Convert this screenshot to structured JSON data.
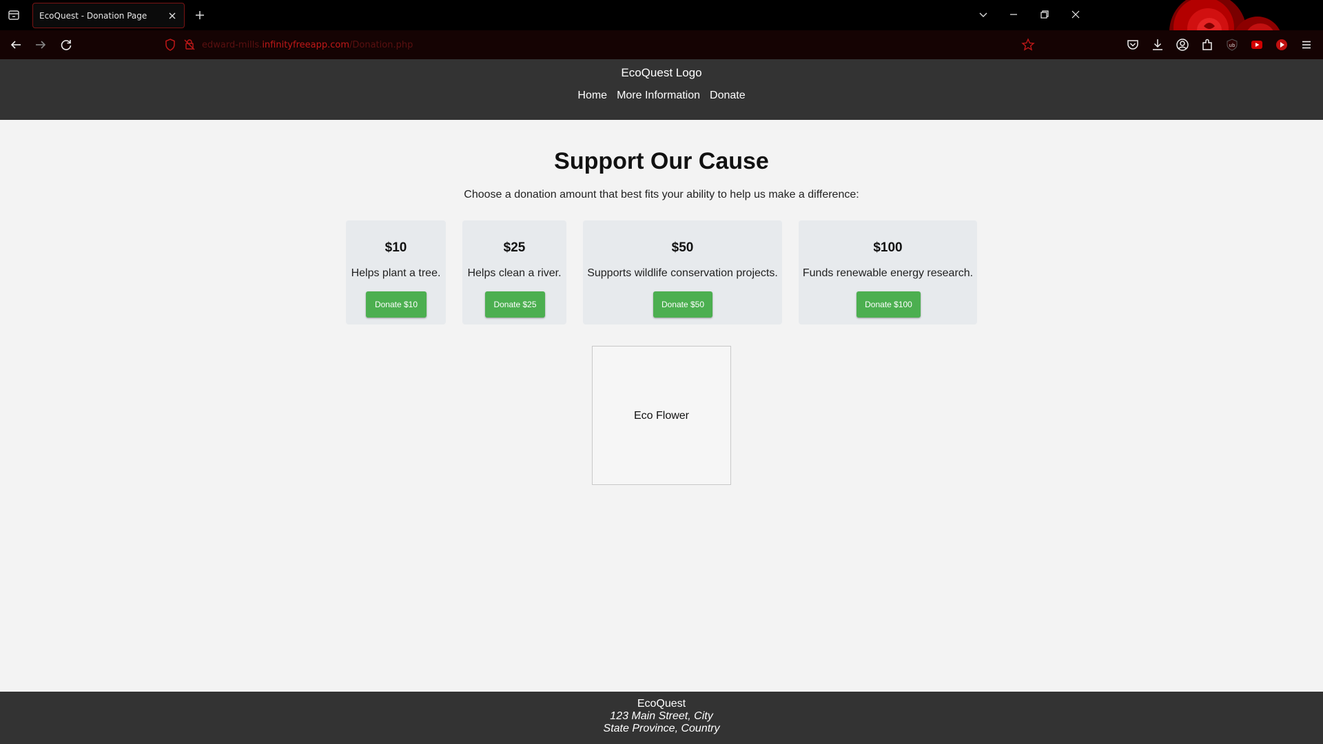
{
  "browser": {
    "tab_title": "EcoQuest - Donation Page",
    "url_prefix": "edward-mills.",
    "url_domain": "infinityfreeapp.com",
    "url_path": "/Donation.php"
  },
  "header": {
    "logo": "EcoQuest Logo",
    "nav": [
      "Home",
      "More Information",
      "Donate"
    ]
  },
  "main": {
    "title": "Support Our Cause",
    "subtitle": "Choose a donation amount that best fits your ability to help us make a difference:",
    "cards": [
      {
        "amount": "$10",
        "description": "Helps plant a tree.",
        "button": "Donate $10"
      },
      {
        "amount": "$25",
        "description": "Helps clean a river.",
        "button": "Donate $25"
      },
      {
        "amount": "$50",
        "description": "Supports wildlife conservation projects.",
        "button": "Donate $50"
      },
      {
        "amount": "$100",
        "description": "Funds renewable energy research.",
        "button": "Donate $100"
      }
    ],
    "image_alt": "Eco Flower"
  },
  "footer": {
    "name": "EcoQuest",
    "address_line1": "123 Main Street, City",
    "address_line2": "State Province, Country"
  },
  "colors": {
    "header_bg": "#333333",
    "button_green": "#4caf50",
    "card_bg": "#e7eaed",
    "browser_accent": "#c01818"
  },
  "icons": {
    "chrome": [
      "tab-list-icon",
      "close-icon",
      "plus-icon",
      "back-arrow-icon",
      "forward-arrow-icon",
      "reload-icon",
      "shield-icon",
      "tracking-blocked-icon",
      "bookmark-star-icon",
      "pocket-icon",
      "download-icon",
      "account-icon",
      "extensions-icon",
      "ublock-icon",
      "youtube-icon",
      "play-icon",
      "menu-icon",
      "chevron-down-icon",
      "minimize-icon",
      "restore-icon"
    ]
  }
}
